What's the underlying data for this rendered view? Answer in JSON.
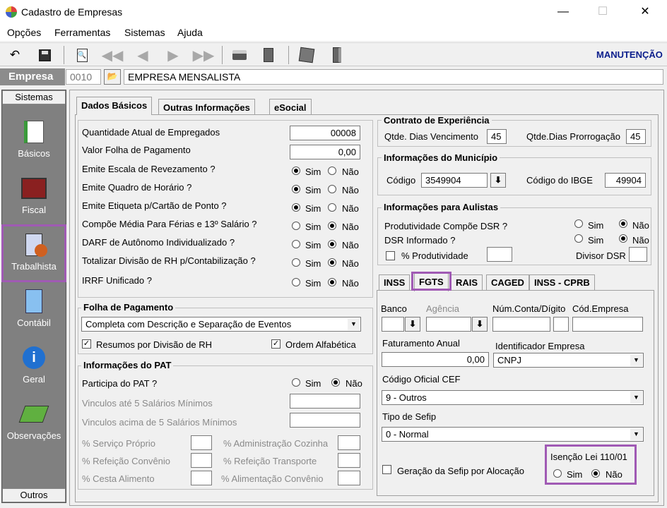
{
  "window": {
    "title": "Cadastro de Empresas",
    "minimize": "—",
    "maximize": "☐",
    "close": "✕"
  },
  "menu": {
    "opcoes": "Opções",
    "ferramentas": "Ferramentas",
    "sistemas": "Sistemas",
    "ajuda": "Ajuda"
  },
  "toolbar": {
    "mode": "MANUTENÇÃO",
    "icons": [
      "undo-icon",
      "save-icon",
      "preview-icon",
      "first-icon",
      "prev-icon",
      "next-icon",
      "last-icon",
      "print-icon",
      "calc-icon",
      "tools-icon",
      "exit-icon"
    ]
  },
  "empresa": {
    "label": "Empresa",
    "code": "0010",
    "name": "EMPRESA MENSALISTA"
  },
  "sidebar": {
    "header": "Sistemas",
    "footer": "Outros",
    "items": [
      {
        "label": "Básicos",
        "icon": "basicos-icon"
      },
      {
        "label": "Fiscal",
        "icon": "fiscal-icon"
      },
      {
        "label": "Trabalhista",
        "icon": "trabalhista-icon"
      },
      {
        "label": "Contábil",
        "icon": "contabil-icon"
      },
      {
        "label": "Geral",
        "icon": "geral-icon"
      },
      {
        "label": "Observações",
        "icon": "observacoes-icon"
      }
    ]
  },
  "tabs": {
    "dados": "Dados Básicos",
    "outras": "Outras Informações",
    "esocial": "eSocial"
  },
  "yes": "Sim",
  "no": "Não",
  "dados": {
    "qtd_label": "Quantidade Atual de Empregados",
    "qtd_value": "00008",
    "valor_label": "Valor Folha de Pagamento",
    "valor_value": "0,00",
    "rows": [
      {
        "label": "Emite Escala de Revezamento ?",
        "value": "Sim"
      },
      {
        "label": "Emite Quadro de Horário ?",
        "value": "Sim"
      },
      {
        "label": "Emite Etiqueta p/Cartão de Ponto ?",
        "value": "Sim"
      },
      {
        "label": "Compõe Média Para Férias e 13º Salário ?",
        "value": "Não"
      },
      {
        "label": "DARF de Autônomo Individualizado ?",
        "value": "Não"
      },
      {
        "label": "Totalizar Divisão de RH p/Contabilização ?",
        "value": "Não"
      },
      {
        "label": "IRRF Unificado ?",
        "value": "Não"
      }
    ]
  },
  "folha": {
    "title": "Folha de Pagamento",
    "select": "Completa com Descrição e Separação de Eventos",
    "resumos": "Resumos por Divisão de RH",
    "ordem": "Ordem Alfabética"
  },
  "pat": {
    "title": "Informações do PAT",
    "participa": "Participa do PAT ?",
    "participa_value": "Não",
    "vinc_ate": "Vinculos até 5 Salários Mínimos",
    "vinc_acima": "Vinculos acima de 5 Salários Mínimos",
    "servico": "% Serviço Próprio",
    "refeicao": "% Refeição Convênio",
    "cesta": "% Cesta Alimento",
    "admin": "% Administração Cozinha",
    "ref_transp": "% Refeição Transporte",
    "alim": "% Alimentação Convênio"
  },
  "contrato": {
    "title": "Contrato de Experiência",
    "venc_label": "Qtde. Dias Vencimento",
    "venc_value": "45",
    "prorr_label": "Qtde.Dias Prorrogação",
    "prorr_value": "45"
  },
  "municipio": {
    "title": "Informações do Município",
    "codigo_label": "Código",
    "codigo_value": "3549904",
    "ibge_label": "Código do IBGE",
    "ibge_value": "49904"
  },
  "aulistas": {
    "title": "Informações para Aulistas",
    "prod_label": "Produtividade Compõe DSR ?",
    "prod_value": "Não",
    "dsr_label": "DSR Informado ?",
    "dsr_value": "Não",
    "perc_label": "% Produtividade",
    "divisor_label": "Divisor DSR"
  },
  "subtabs": {
    "inss": "INSS",
    "fgts": "FGTS",
    "rais": "RAIS",
    "caged": "CAGED",
    "cprb": "INSS - CPRB"
  },
  "fgts": {
    "banco": "Banco",
    "agencia": "Agência",
    "conta": "Núm.Conta/Dígito",
    "cod_empresa": "Cód.Empresa",
    "fat_label": "Faturamento Anual",
    "fat_value": "0,00",
    "ident_label": "Identificador Empresa",
    "ident_value": "CNPJ",
    "cef_label": "Código Oficial CEF",
    "cef_value": "9 - Outros",
    "sefip_label": "Tipo de Sefip",
    "sefip_value": "0 - Normal",
    "geracao": "Geração da Sefip por Alocação",
    "isencao_label": "Isenção Lei 110/01",
    "isencao_value": "Não"
  },
  "colors": {
    "highlight": "#a05ab4",
    "mode": "#0a1e8c",
    "sidebar": "#808080"
  }
}
